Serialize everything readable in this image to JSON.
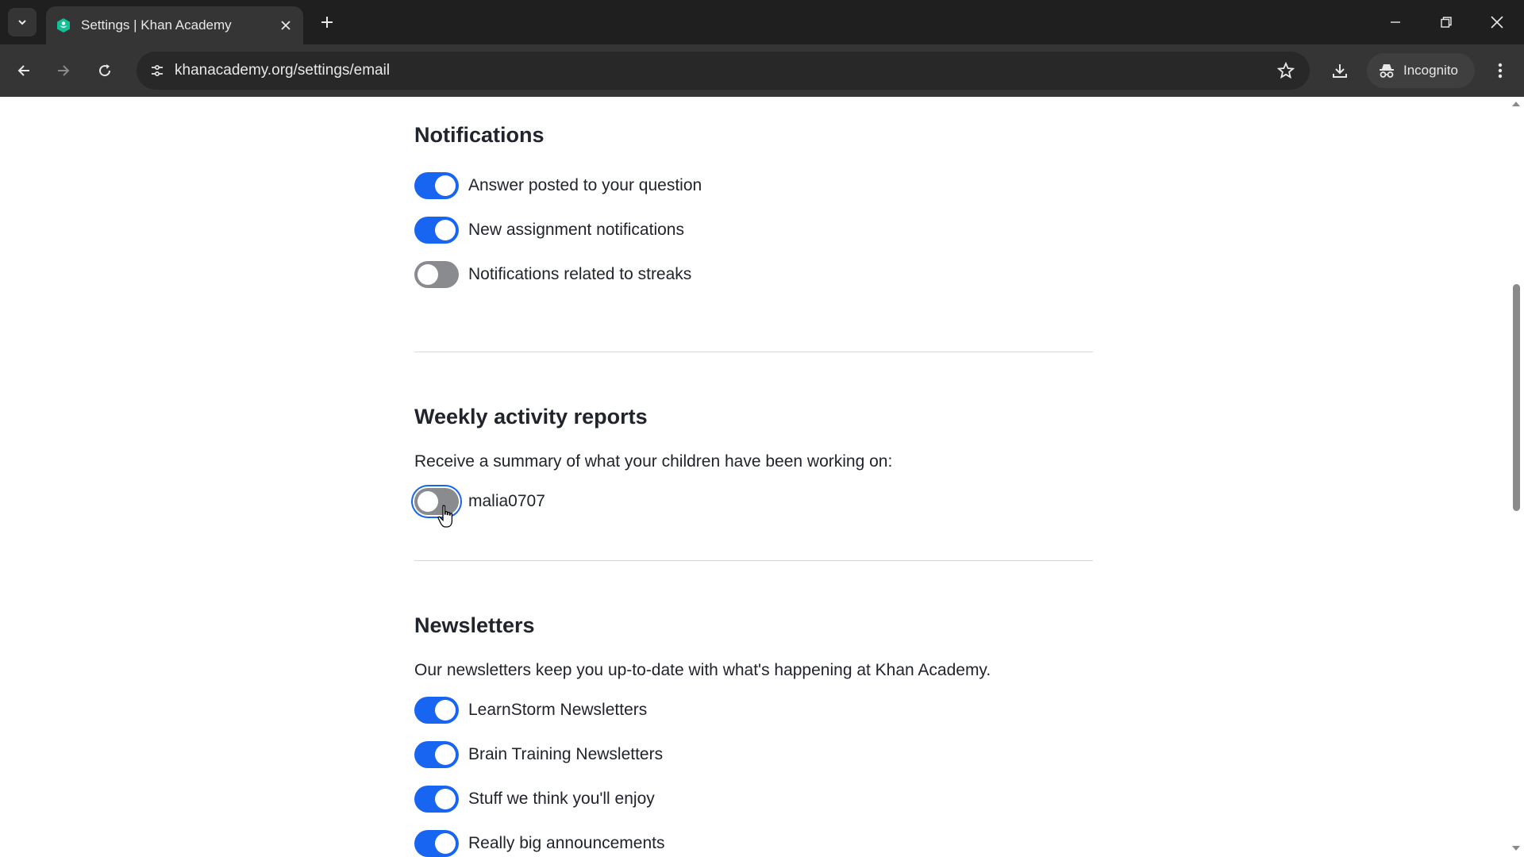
{
  "browser": {
    "tab_title": "Settings | Khan Academy",
    "url": "khanacademy.org/settings/email",
    "incognito_label": "Incognito"
  },
  "notifications": {
    "title": "Notifications",
    "items": [
      {
        "label": "Answer posted to your question",
        "enabled": true
      },
      {
        "label": "New assignment notifications",
        "enabled": true
      },
      {
        "label": "Notifications related to streaks",
        "enabled": false
      }
    ]
  },
  "weekly_reports": {
    "title": "Weekly activity reports",
    "description": "Receive a summary of what your children have been working on:",
    "items": [
      {
        "label": "malia0707",
        "enabled": false
      }
    ]
  },
  "newsletters": {
    "title": "Newsletters",
    "description": "Our newsletters keep you up-to-date with what's happening at Khan Academy.",
    "items": [
      {
        "label": "LearnStorm Newsletters",
        "enabled": true
      },
      {
        "label": "Brain Training Newsletters",
        "enabled": true
      },
      {
        "label": "Stuff we think you'll enjoy",
        "enabled": true
      },
      {
        "label": "Really big announcements",
        "enabled": true
      }
    ]
  },
  "colors": {
    "toggle_on": "#1865f2",
    "toggle_off": "#8a8b8f",
    "chrome_dark": "#1f1f1f",
    "chrome_toolbar": "#353535",
    "favicon_green": "#14bf96"
  }
}
